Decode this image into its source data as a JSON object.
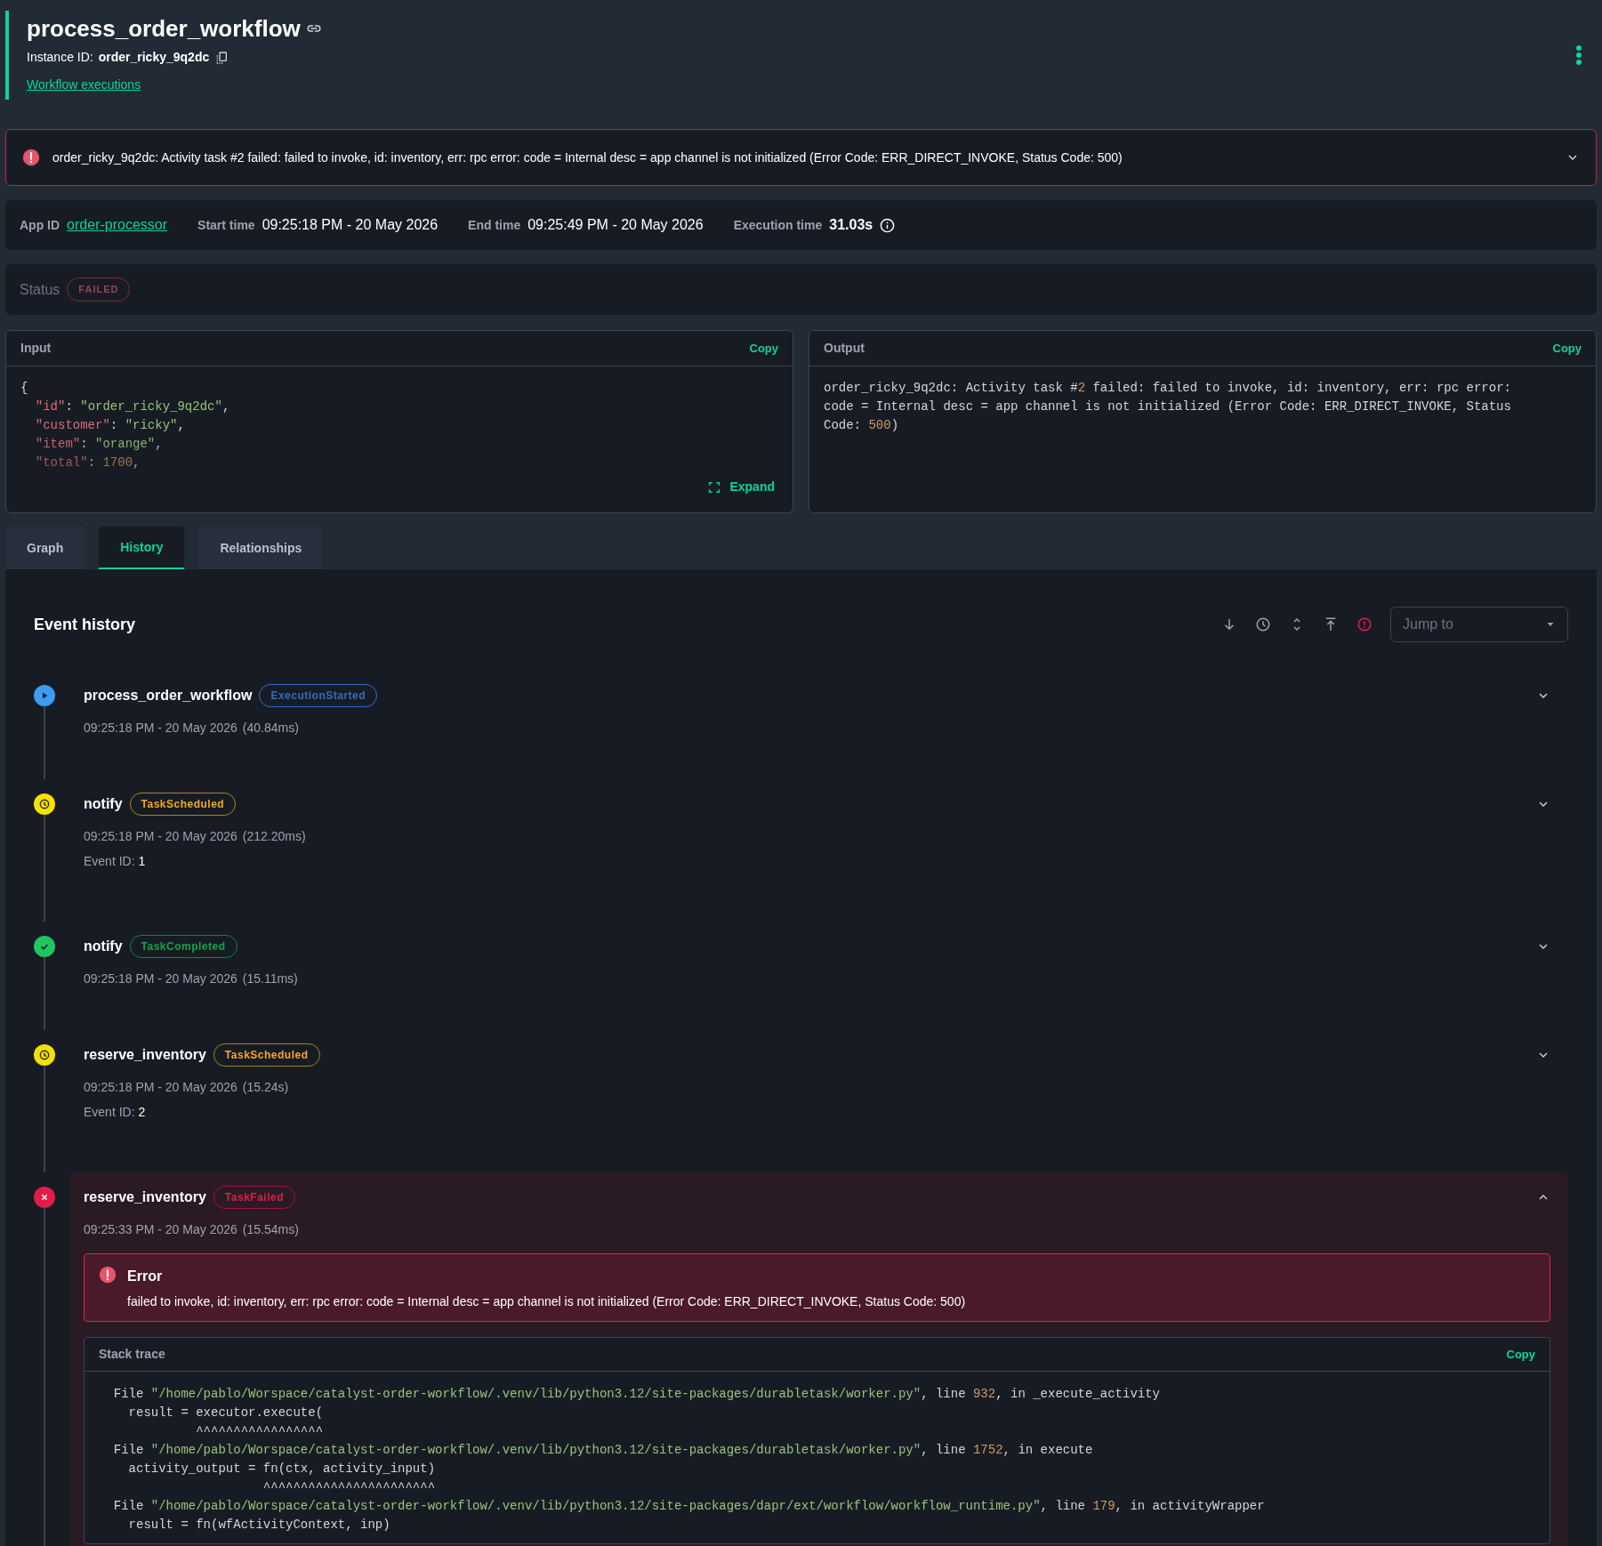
{
  "header": {
    "title": "process_order_workflow",
    "instance_label": "Instance ID:",
    "instance_id": "order_ricky_9q2dc",
    "link": "Workflow executions"
  },
  "alert": {
    "message": "order_ricky_9q2dc: Activity task #2 failed: failed to invoke, id: inventory, err: rpc error: code = Internal desc = app channel is not initialized (Error Code: ERR_DIRECT_INVOKE, Status Code: 500)",
    "expanded": false
  },
  "info": [
    {
      "label": "App ID",
      "value": "order-processor",
      "kind": "link"
    },
    {
      "label": "Start time",
      "value": "09:25:18 PM - 20 May 2026",
      "kind": "text"
    },
    {
      "label": "End time",
      "value": "09:25:49 PM - 20 May 2026",
      "kind": "text"
    },
    {
      "label": "Execution time",
      "value": "31.03s",
      "kind": "duration"
    }
  ],
  "status": {
    "label": "Status",
    "value": "FAILED"
  },
  "input": {
    "title": "Input",
    "copy": "Copy",
    "expand": "Expand",
    "lines": [
      "{",
      "  \"id\": \"order_ricky_9q2dc\",",
      "  \"customer\": \"ricky\",",
      "  \"item\": \"orange\",",
      "  \"total\": 1700,"
    ]
  },
  "output": {
    "title": "Output",
    "copy": "Copy",
    "text": "order_ricky_9q2dc: Activity task #2 failed: failed to invoke, id: inventory, err: rpc error: code = Internal desc = app channel is not initialized (Error Code: ERR_DIRECT_INVOKE, Status Code: 500)"
  },
  "tabs": [
    {
      "label": "Graph",
      "selected": false
    },
    {
      "label": "History",
      "selected": true
    },
    {
      "label": "Relationships",
      "selected": false
    }
  ],
  "history": {
    "title": "Event history",
    "jump_placeholder": "Jump to",
    "events": [
      {
        "name": "process_order_workflow",
        "badge": "ExecutionStarted",
        "kind": "started",
        "time": "09:25:18 PM - 20 May 2026",
        "duration": "(40.84ms)",
        "expanded": false
      },
      {
        "name": "notify",
        "badge": "TaskScheduled",
        "kind": "scheduled",
        "time": "09:25:18 PM - 20 May 2026",
        "duration": "(212.20ms)",
        "event_id_label": "Event ID:",
        "event_id": "1",
        "expanded": false
      },
      {
        "name": "notify",
        "badge": "TaskCompleted",
        "kind": "completed",
        "time": "09:25:18 PM - 20 May 2026",
        "duration": "(15.11ms)",
        "expanded": false
      },
      {
        "name": "reserve_inventory",
        "badge": "TaskScheduled",
        "kind": "scheduled",
        "time": "09:25:18 PM - 20 May 2026",
        "duration": "(15.24s)",
        "event_id_label": "Event ID:",
        "event_id": "2",
        "expanded": false
      },
      {
        "name": "reserve_inventory",
        "badge": "TaskFailed",
        "kind": "failed",
        "time": "09:25:33 PM - 20 May 2026",
        "duration": "(15.54ms)",
        "expanded": true,
        "error": {
          "title": "Error",
          "message": "failed to invoke, id: inventory, err: rpc error: code = Internal desc = app channel is not initialized (Error Code: ERR_DIRECT_INVOKE, Status Code: 500)"
        },
        "stack_trace": {
          "title": "Stack trace",
          "copy": "Copy",
          "lines": [
            "  File \"/home/pablo/Worspace/catalyst-order-workflow/.venv/lib/python3.12/site-packages/durabletask/worker.py\", line 932, in _execute_activity",
            "    result = executor.execute(",
            "             ^^^^^^^^^^^^^^^^^",
            "  File \"/home/pablo/Worspace/catalyst-order-workflow/.venv/lib/python3.12/site-packages/durabletask/worker.py\", line 1752, in execute",
            "    activity_output = fn(ctx, activity_input)",
            "                      ^^^^^^^^^^^^^^^^^^^^^^^",
            "  File \"/home/pablo/Worspace/catalyst-order-workflow/.venv/lib/python3.12/site-packages/dapr/ext/workflow/workflow_runtime.py\", line 179, in activityWrapper",
            "    result = fn(wfActivityContext, inp)"
          ]
        }
      }
    ]
  }
}
